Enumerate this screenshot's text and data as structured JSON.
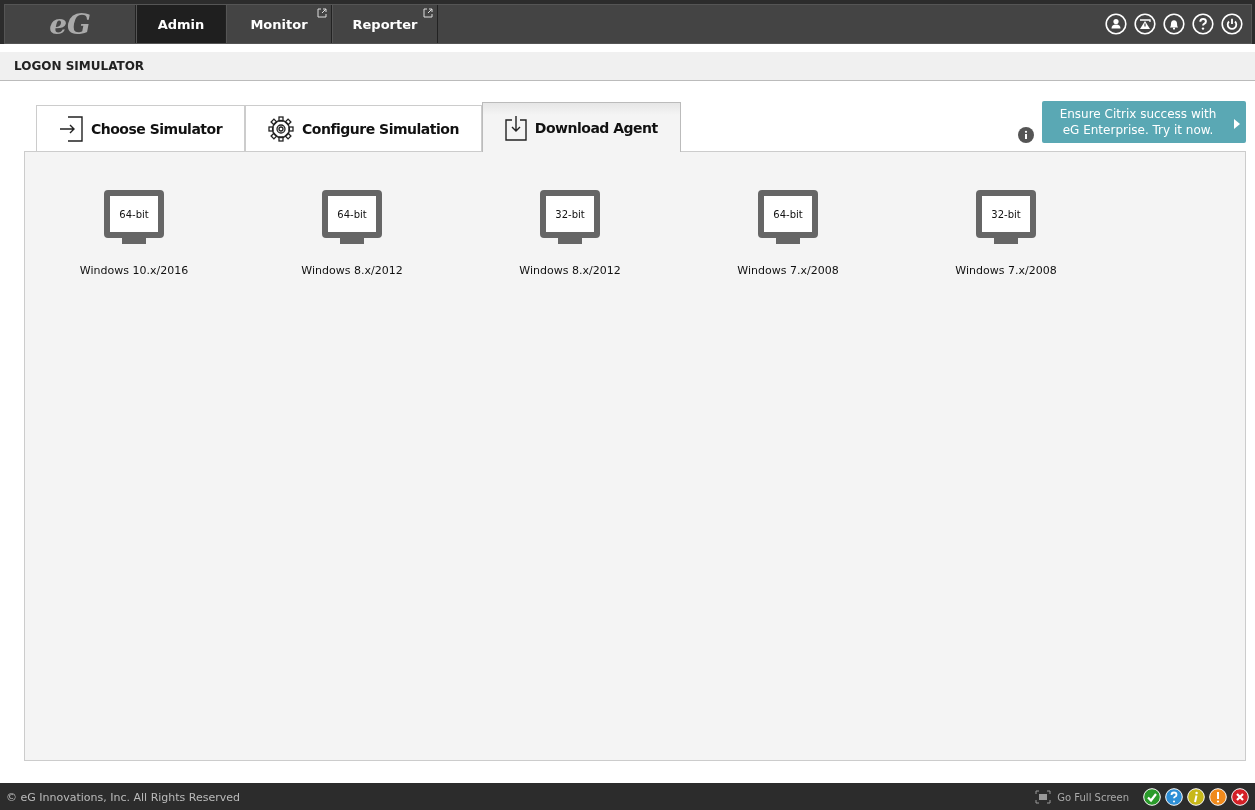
{
  "logo": {
    "text": "eG"
  },
  "nav_tabs": [
    {
      "label": "Admin",
      "selected": true,
      "external": false
    },
    {
      "label": "Monitor",
      "selected": false,
      "external": true
    },
    {
      "label": "Reporter",
      "selected": false,
      "external": true
    }
  ],
  "header_icons": [
    {
      "kind": "user"
    },
    {
      "kind": "alert"
    },
    {
      "kind": "bell"
    },
    {
      "kind": "help"
    },
    {
      "kind": "power"
    }
  ],
  "page_title": "LOGON SIMULATOR",
  "tabs": [
    {
      "label": "Choose Simulator",
      "kind": "enter",
      "selected": false
    },
    {
      "label": "Configure Simulation",
      "kind": "gear",
      "selected": false
    },
    {
      "label": "Download Agent",
      "kind": "download",
      "selected": true
    }
  ],
  "promo": {
    "text": "Ensure Citrix success with eG Enterprise. Try it now."
  },
  "agents": [
    {
      "bits": "64-bit",
      "name": "Windows 10.x/2016"
    },
    {
      "bits": "64-bit",
      "name": "Windows 8.x/2012"
    },
    {
      "bits": "32-bit",
      "name": "Windows 8.x/2012"
    },
    {
      "bits": "64-bit",
      "name": "Windows 7.x/2008"
    },
    {
      "bits": "32-bit",
      "name": "Windows 7.x/2008"
    }
  ],
  "footer": {
    "copyright": "© eG Innovations, Inc. All Rights Reserved",
    "full_screen": "Go Full Screen",
    "status_icons": [
      {
        "kind": "ok",
        "color": "#2a9a2a"
      },
      {
        "kind": "help",
        "color": "#2e8fd6"
      },
      {
        "kind": "info",
        "color": "#c8b81a"
      },
      {
        "kind": "warning",
        "color": "#f08a1c"
      },
      {
        "kind": "error",
        "color": "#d42027"
      }
    ]
  }
}
